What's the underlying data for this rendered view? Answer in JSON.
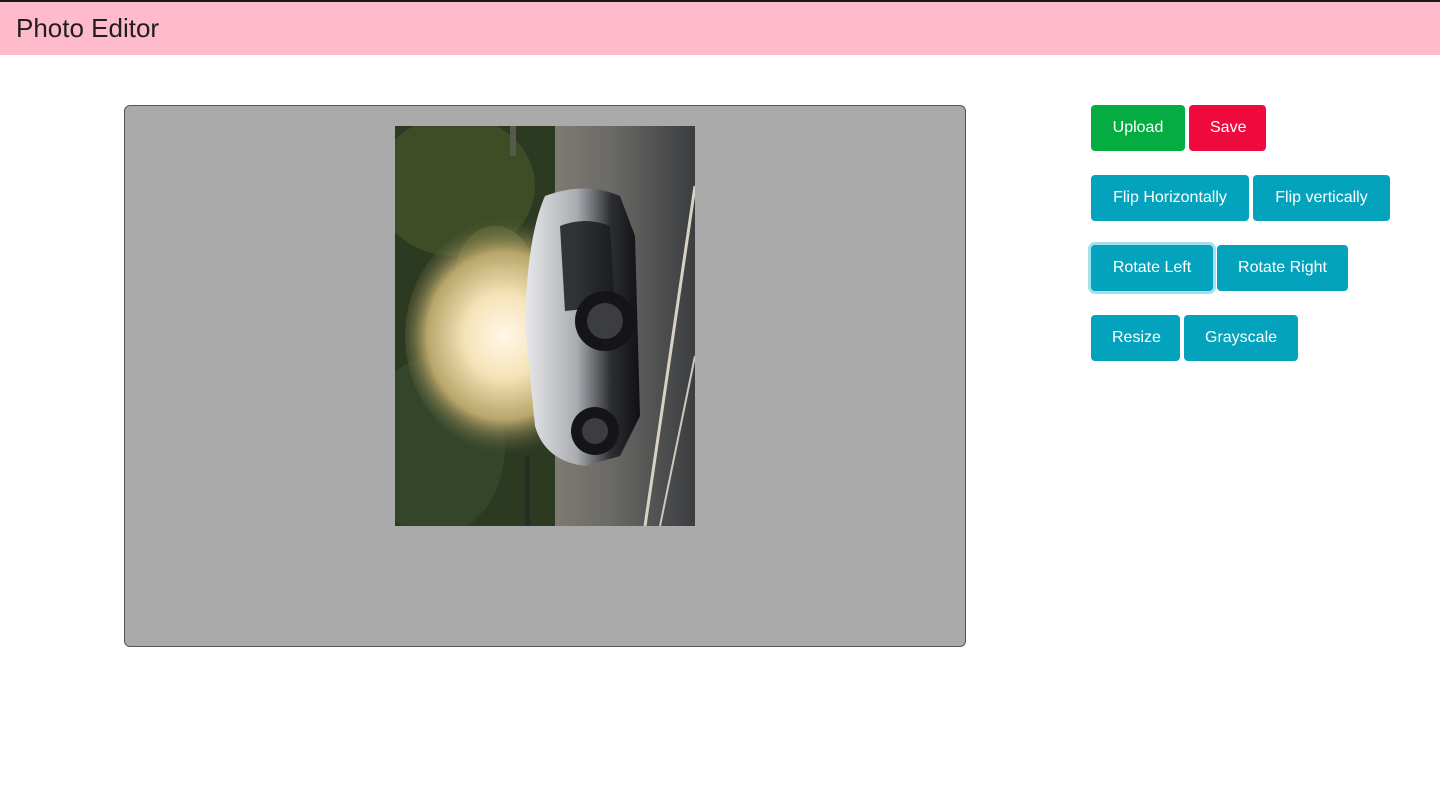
{
  "header": {
    "title": "Photo Editor",
    "background": "#ffbbcb"
  },
  "editor": {
    "canvas_background": "#aaaaaa",
    "photo": {
      "description_icon": "rotated-car-photo",
      "rotation": "90deg clockwise"
    }
  },
  "toolbar": {
    "upload_label": "Upload",
    "save_label": "Save",
    "flip_horizontal_label": "Flip Horizontally",
    "flip_vertical_label": "Flip vertically",
    "rotate_left_label": "Rotate Left",
    "rotate_right_label": "Rotate Right",
    "resize_label": "Resize",
    "grayscale_label": "Grayscale",
    "focused_button": "Rotate Left"
  },
  "colors": {
    "success": "#04ac42",
    "danger": "#ef0a3e",
    "info": "#04a3bd"
  }
}
